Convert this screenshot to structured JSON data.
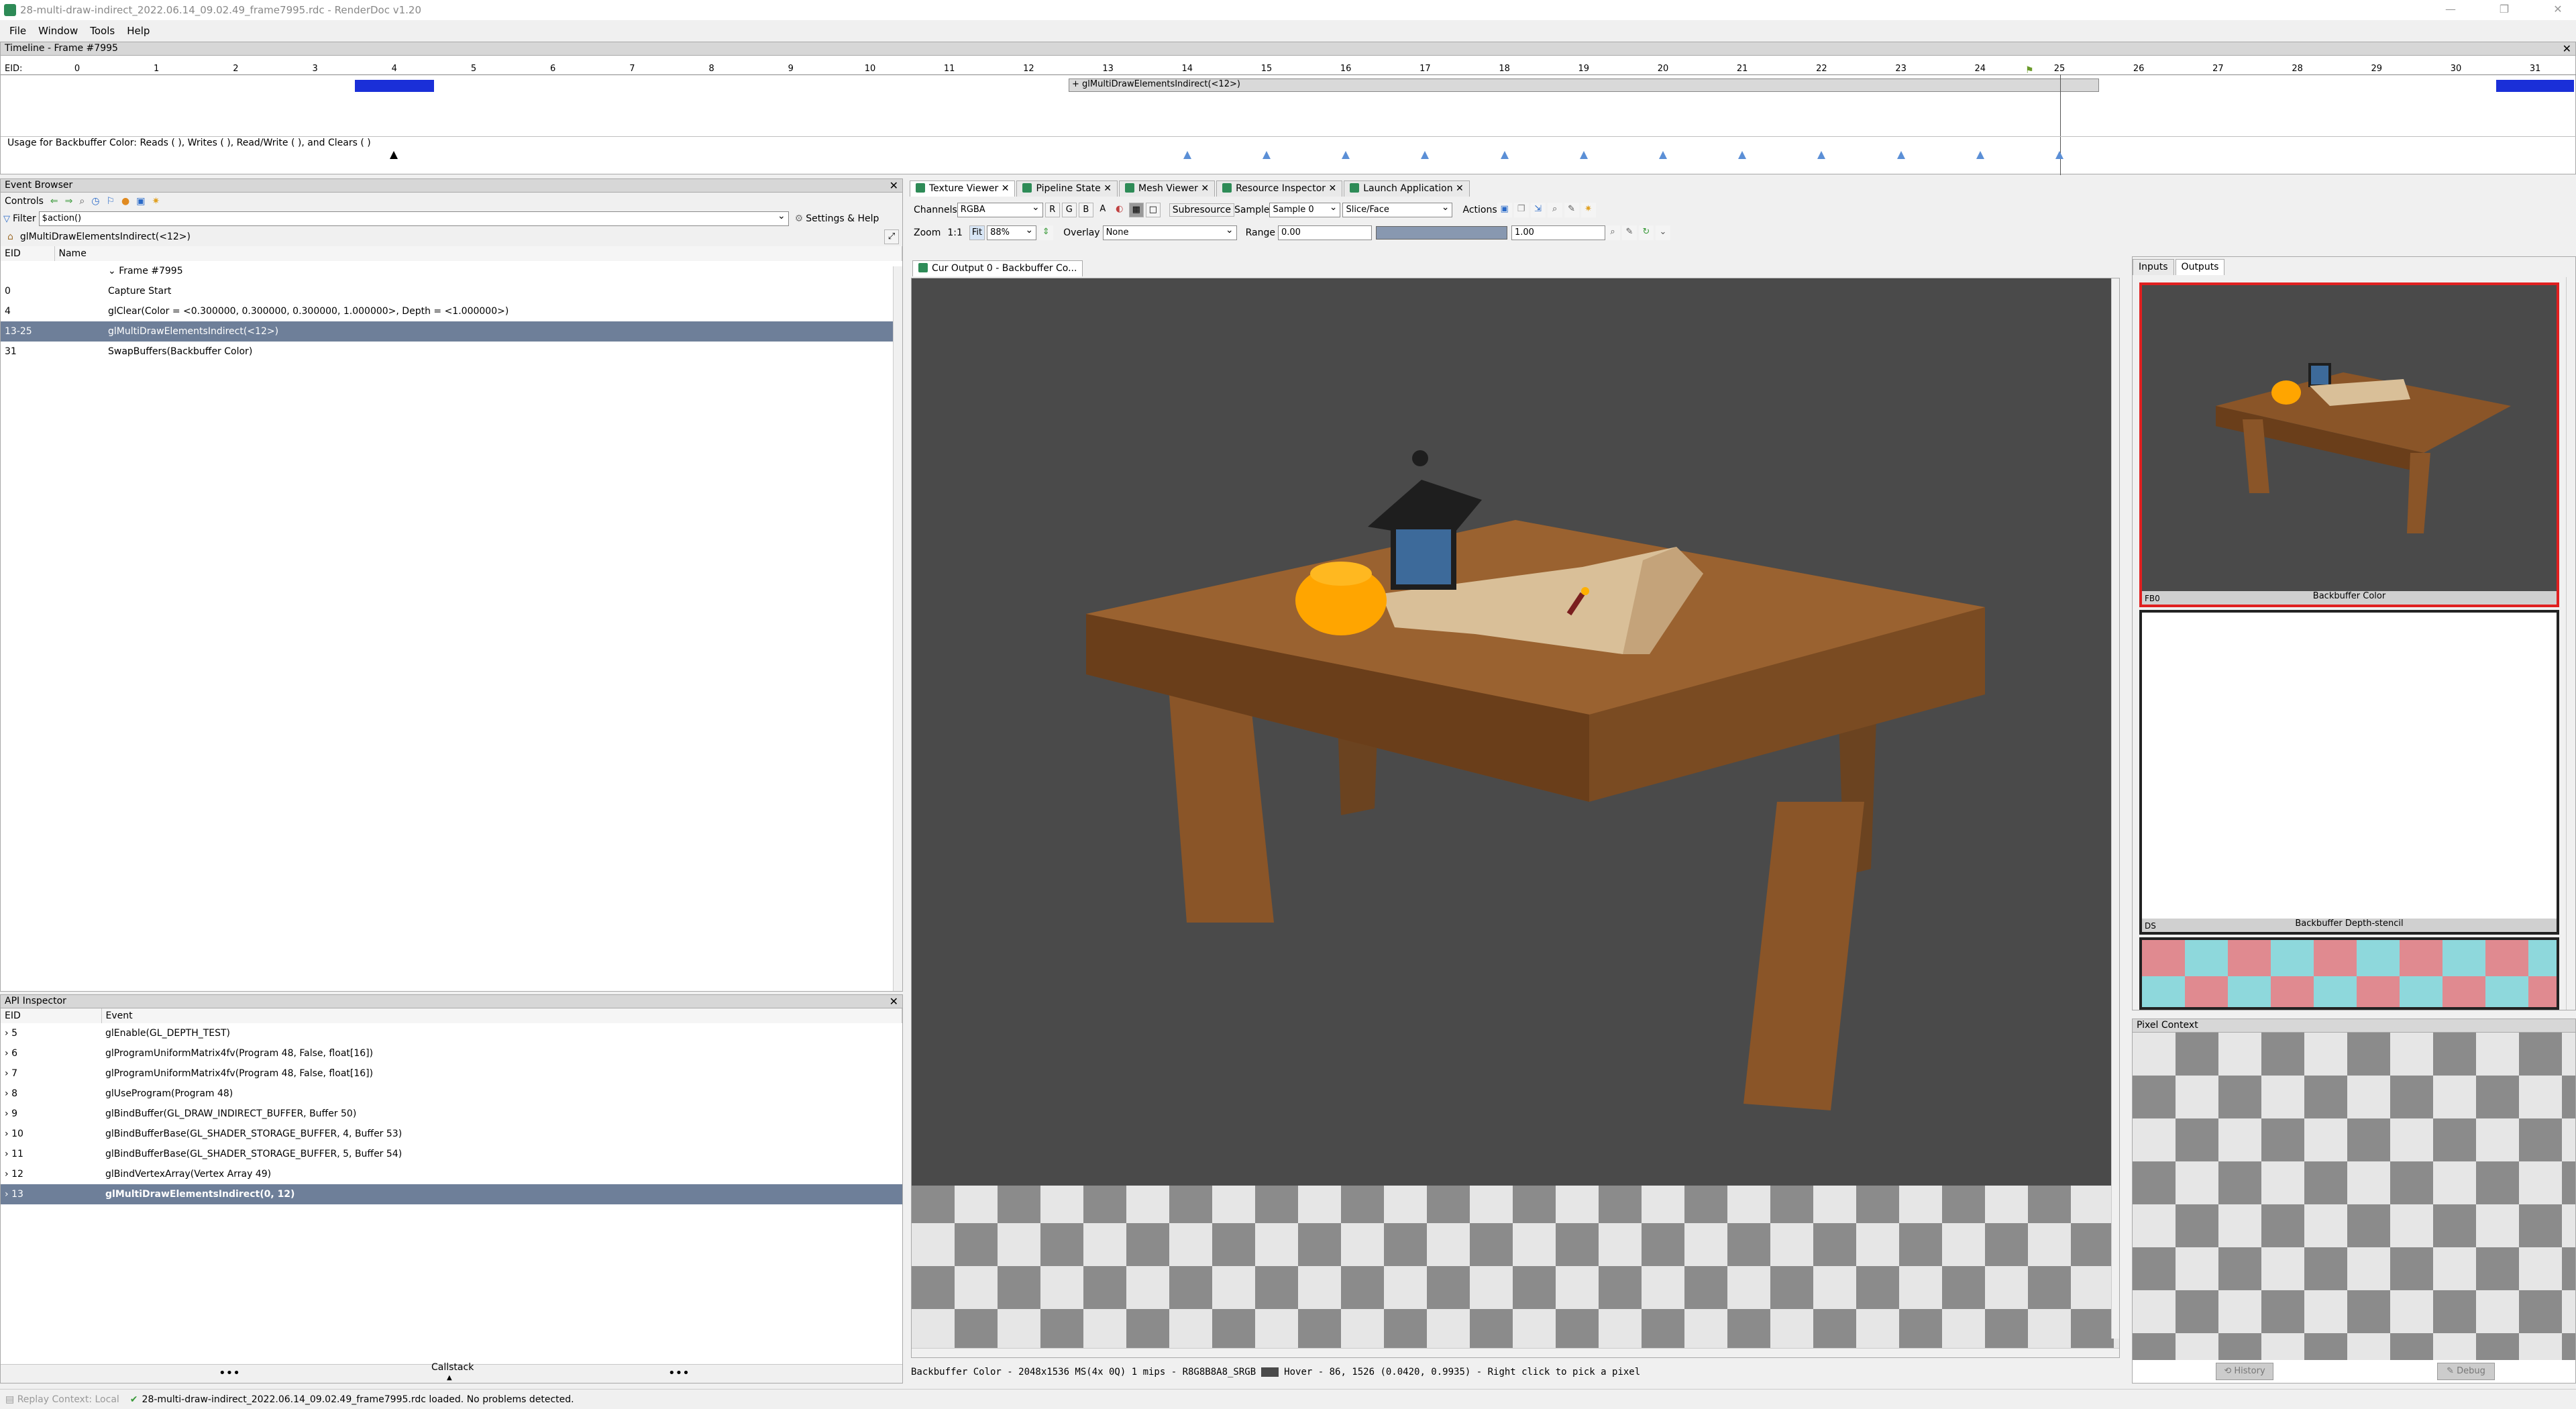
{
  "window": {
    "title": "28-multi-draw-indirect_2022.06.14_09.02.49_frame7995.rdc - RenderDoc v1.20"
  },
  "menu": [
    "File",
    "Window",
    "Tools",
    "Help"
  ],
  "timeline": {
    "title": "Timeline - Frame #7995",
    "eid_label": "EID:",
    "ticks": [
      "0",
      "1",
      "2",
      "3",
      "4",
      "5",
      "6",
      "7",
      "8",
      "9",
      "10",
      "11",
      "12",
      "13",
      "14",
      "15",
      "16",
      "17",
      "18",
      "19",
      "20",
      "21",
      "22",
      "23",
      "24",
      "25",
      "26",
      "27",
      "28",
      "29",
      "30",
      "31"
    ],
    "draw_label": "+ glMultiDrawElementsIndirect(<12>)",
    "usage_text": "Usage for Backbuffer Color: Reads ( ), Writes ( ), Read/Write ( ), and Clears ( )"
  },
  "event_browser": {
    "title": "Event Browser",
    "controls_label": "Controls",
    "filter_label": "Filter",
    "filter_value": "$action()",
    "settings_label": "Settings & Help",
    "current": "glMultiDrawElementsIndirect(<12>)",
    "columns": [
      "EID",
      "Name"
    ],
    "rows": [
      {
        "eid": "",
        "name": "Frame #7995",
        "indent": 1
      },
      {
        "eid": "0",
        "name": "Capture Start",
        "indent": 2
      },
      {
        "eid": "4",
        "name": "glClear(Color = <0.300000, 0.300000, 0.300000, 1.000000>, Depth = <1.000000>)",
        "indent": 2
      },
      {
        "eid": "13-25",
        "name": "glMultiDrawElementsIndirect(<12>)",
        "indent": 2,
        "selected": true
      },
      {
        "eid": "31",
        "name": "SwapBuffers(Backbuffer Color)",
        "indent": 2
      }
    ]
  },
  "api_inspector": {
    "title": "API Inspector",
    "columns": [
      "EID",
      "Event"
    ],
    "rows": [
      {
        "eid": "5",
        "event": "glEnable(GL_DEPTH_TEST)"
      },
      {
        "eid": "6",
        "event": "glProgramUniformMatrix4fv(Program 48, False, float[16])"
      },
      {
        "eid": "7",
        "event": "glProgramUniformMatrix4fv(Program 48, False, float[16])"
      },
      {
        "eid": "8",
        "event": "glUseProgram(Program 48)"
      },
      {
        "eid": "9",
        "event": "glBindBuffer(GL_DRAW_INDIRECT_BUFFER, Buffer 50)"
      },
      {
        "eid": "10",
        "event": "glBindBufferBase(GL_SHADER_STORAGE_BUFFER, 4, Buffer 53)"
      },
      {
        "eid": "11",
        "event": "glBindBufferBase(GL_SHADER_STORAGE_BUFFER, 5, Buffer 54)"
      },
      {
        "eid": "12",
        "event": "glBindVertexArray(Vertex Array 49)"
      },
      {
        "eid": "13",
        "event": "glMultiDrawElementsIndirect(0, 12)",
        "selected": true
      }
    ],
    "callstack_label": "Callstack"
  },
  "tabs": [
    "Texture Viewer",
    "Pipeline State",
    "Mesh Viewer",
    "Resource Inspector",
    "Launch Application"
  ],
  "toolbar": {
    "channels_label": "Channels",
    "channels_value": "RGBA",
    "r": "R",
    "g": "G",
    "b": "B",
    "a": "A",
    "subresource_label": "Subresource",
    "sample_label": "Sample",
    "sample_value": "Sample 0",
    "slice_label": "Slice/Face",
    "actions_label": "Actions",
    "zoom_label": "Zoom",
    "zoom_11": "1:1",
    "fit_label": "Fit",
    "zoom_value": "88%",
    "overlay_label": "Overlay",
    "overlay_value": "None",
    "range_label": "Range",
    "range_min": "0.00",
    "range_max": "1.00"
  },
  "viewer": {
    "tab_label": "Cur Output 0 - Backbuffer Co...",
    "status": "Backbuffer Color - 2048x1536 MS(4x 0Q) 1 mips - R8G8B8A8_SRGB",
    "hover": "Hover -    86, 1526 (0.0420, 0.9935)  - Right click to pick a pixel"
  },
  "thumbnails": {
    "tab_inputs": "Inputs",
    "tab_outputs": "Outputs",
    "items": [
      {
        "slot": "FB0",
        "label": "Backbuffer Color"
      },
      {
        "slot": "DS",
        "label": "Backbuffer Depth-stencil"
      }
    ]
  },
  "pixel_context": {
    "title": "Pixel Context",
    "history": "History",
    "debug": "Debug"
  },
  "statusbar": {
    "replay": "Replay Context: Local",
    "message": "28-multi-draw-indirect_2022.06.14_09.02.49_frame7995.rdc loaded. No problems detected."
  }
}
